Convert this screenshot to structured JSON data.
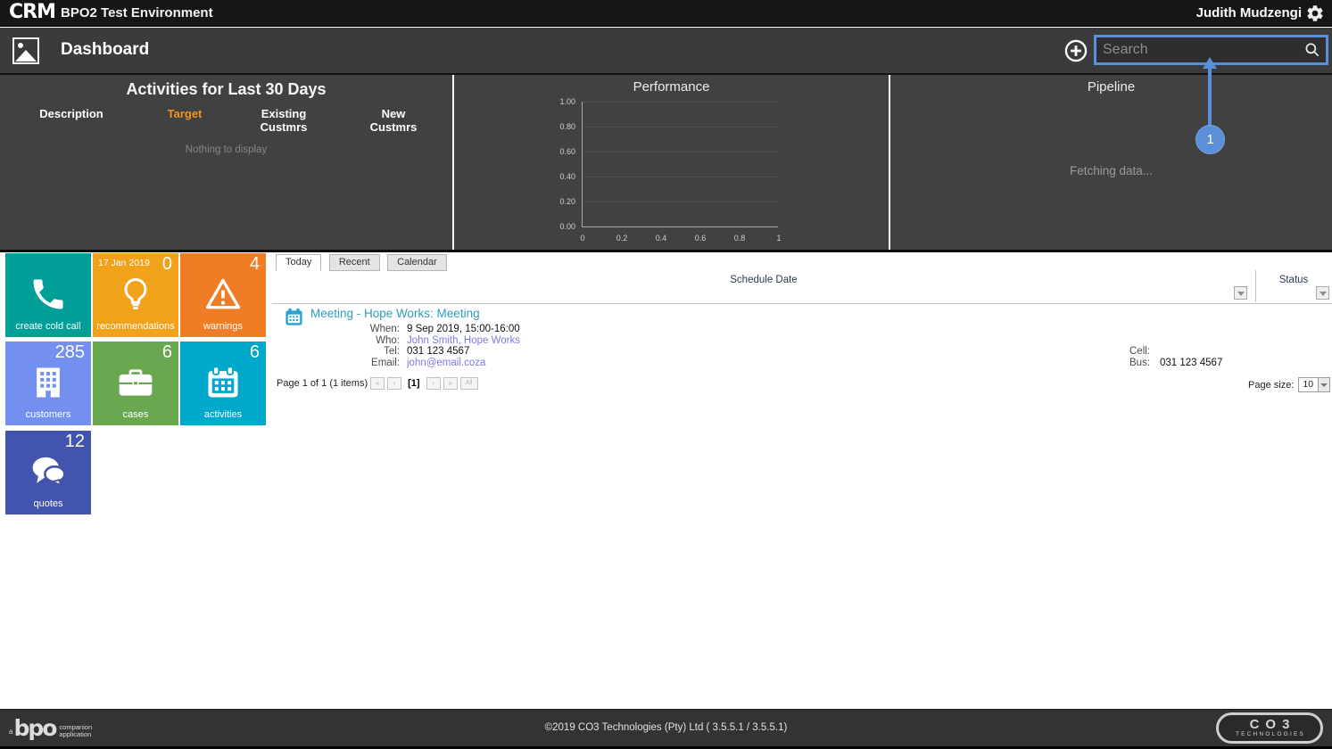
{
  "topbar": {
    "logo": "CRM",
    "environment": "BPO2 Test Environment",
    "user": "Judith Mudzengi"
  },
  "appbar": {
    "title": "Dashboard",
    "search_placeholder": "Search"
  },
  "callout": {
    "number": "1"
  },
  "panels": {
    "activities": {
      "title": "Activities for Last 30 Days",
      "columns": [
        "Description",
        "Target",
        "Existing Custmrs",
        "New Custmrs"
      ],
      "empty_text": "Nothing to display"
    },
    "pipeline": {
      "title": "Pipeline",
      "status_text": "Fetching data..."
    }
  },
  "chart_data": {
    "type": "line",
    "title": "Performance",
    "series": [],
    "note": "empty chart, no data plotted",
    "x_ticks": [
      "0",
      "0.2",
      "0.4",
      "0.6",
      "0.8",
      "1"
    ],
    "y_ticks": [
      "0.00",
      "0.20",
      "0.40",
      "0.60",
      "0.80",
      "1.00"
    ],
    "xlim": [
      0,
      1
    ],
    "ylim": [
      0,
      1
    ],
    "grid": true,
    "legend": false
  },
  "tiles": [
    {
      "label": "create cold call",
      "count": "",
      "date": ""
    },
    {
      "label": "recommendations",
      "count": "0",
      "date": "17 Jan 2019"
    },
    {
      "label": "warnings",
      "count": "4",
      "date": ""
    },
    {
      "label": "customers",
      "count": "285",
      "date": ""
    },
    {
      "label": "cases",
      "count": "6",
      "date": ""
    },
    {
      "label": "activities",
      "count": "6",
      "date": ""
    },
    {
      "label": "quotes",
      "count": "12",
      "date": ""
    }
  ],
  "tile_colors": {
    "create_cold_call": "#00a099",
    "recommendations": "#f0a21b",
    "warnings": "#f07d26",
    "customers": "#7390f0",
    "cases": "#69a850",
    "activities": "#00a9cb",
    "quotes": "#4254ae"
  },
  "schedule": {
    "tabs": [
      {
        "label": "Today"
      },
      {
        "label": "Recent"
      },
      {
        "label": "Calendar"
      }
    ],
    "active_tab": "Today",
    "columns": {
      "schedule_date": "Schedule Date",
      "status": "Status"
    },
    "meeting": {
      "title": "Meeting - Hope Works: Meeting",
      "when_label": "When:",
      "when_value": "9 Sep 2019, 15:00-16:00",
      "who_label": "Who:",
      "who_value": "John Smith, Hope Works",
      "tel_label": "Tel:",
      "tel_value": "031 123 4567",
      "email_label": "Email:",
      "email_value": "john@email.coza",
      "cell_label": "Cell:",
      "cell_value": "",
      "bus_label": "Bus:",
      "bus_value": "031 123 4567"
    },
    "pager": {
      "summary": "Page 1 of 1 (1 items)",
      "first": "«",
      "prev": "‹",
      "current": "[1]",
      "next": "›",
      "last": "»",
      "all": "All",
      "page_size_label": "Page size:",
      "page_size_value": "10"
    }
  },
  "footer": {
    "left_a": "a",
    "left_logo": "bpo",
    "left_line1": "companion",
    "left_line2": "application",
    "center": "©2019 CO3 Technologies (Pty) Ltd ( 3.5.5.1 / 3.5.5.1)",
    "logo_text": "CO3",
    "logo_sub": "TECHNOLOGIES"
  },
  "accent_colors": {
    "callout": "#5b8fd9",
    "target_header": "#f0941e",
    "meeting_title": "#2d9cbe",
    "link": "#7b7be4"
  }
}
